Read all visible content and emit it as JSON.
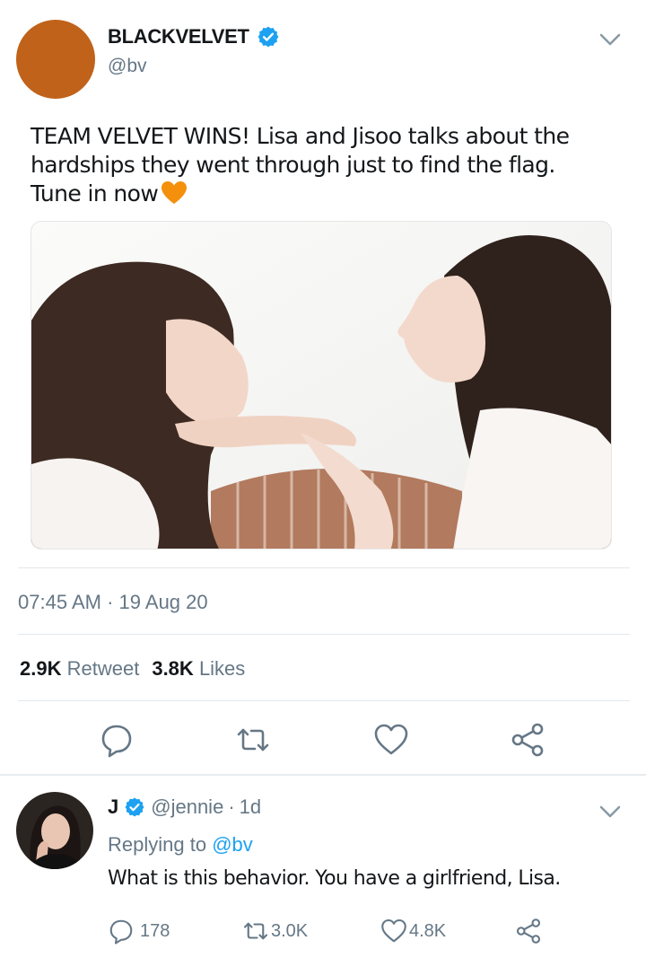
{
  "tweet": {
    "author_name": "BLACKVELVET",
    "author_handle": "@bv",
    "text": "TEAM VELVET WINS! Lisa and Jisoo talks about the hardships they went through just to find the flag. Tune in now",
    "emoji": "orange-heart-emoji",
    "time": "07:45 AM",
    "separator": "·",
    "date": "19 Aug 20",
    "retweets_count": "2.9K",
    "retweets_label": "Retweet",
    "likes_count": "3.8K",
    "likes_label": "Likes"
  },
  "reply": {
    "author_name": "J",
    "author_handle": "@jennie",
    "separator": "·",
    "age": "1d",
    "replying_label": "Replying to",
    "replying_to": "@bv",
    "text": "What is this behavior. You have a girlfriend, Lisa.",
    "replies": "178",
    "retweets": "3.0K",
    "likes": "4.8K"
  },
  "colors": {
    "accent": "#1da1f2",
    "muted": "#657786",
    "avatar": "#c0621a",
    "divider": "#e1e8ed"
  }
}
